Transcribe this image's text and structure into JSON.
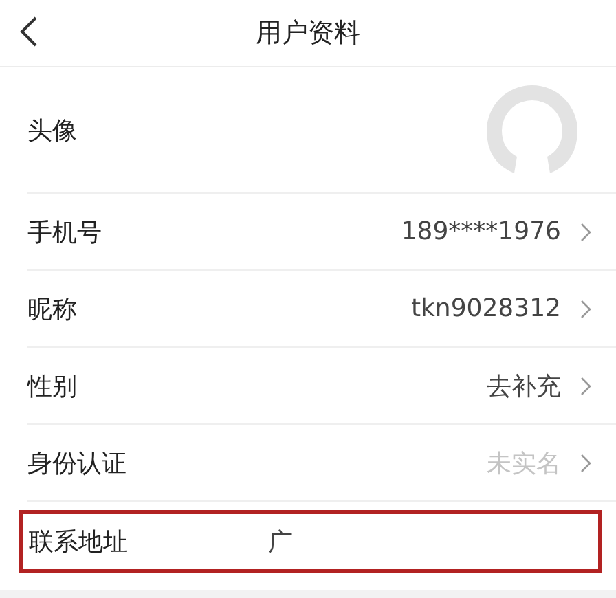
{
  "header": {
    "title": "用户资料"
  },
  "rows": [
    {
      "kind": "avatar",
      "label": "头像"
    },
    {
      "kind": "text",
      "label": "手机号",
      "value": "189****1976",
      "muted": false,
      "chevron": true,
      "highlighted": false
    },
    {
      "kind": "text",
      "label": "昵称",
      "value": "tkn9028312",
      "muted": false,
      "chevron": true,
      "highlighted": false
    },
    {
      "kind": "text",
      "label": "性别",
      "value": "去补充",
      "muted": false,
      "chevron": true,
      "highlighted": false
    },
    {
      "kind": "text",
      "label": "身份认证",
      "value": "未实名",
      "muted": true,
      "chevron": true,
      "highlighted": false
    },
    {
      "kind": "text",
      "label": "联系地址",
      "value": "广",
      "muted": false,
      "chevron": false,
      "highlighted": true
    }
  ]
}
